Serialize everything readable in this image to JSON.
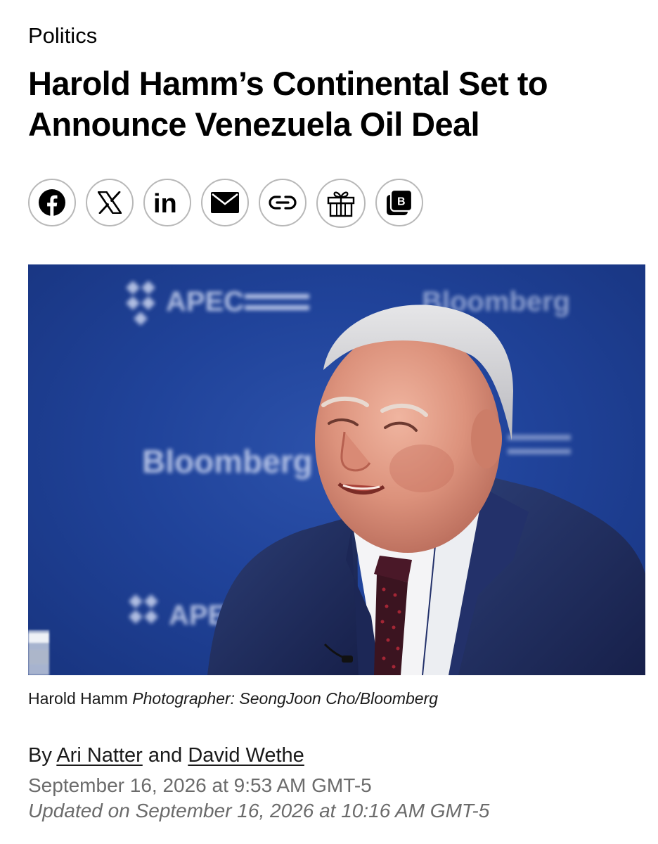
{
  "article": {
    "section": "Politics",
    "headline": "Harold Hamm’s Continental Set to Announce Venezuela Oil Deal"
  },
  "share": {
    "buttons": [
      {
        "icon": "facebook-icon"
      },
      {
        "icon": "x-icon"
      },
      {
        "icon": "linkedin-icon"
      },
      {
        "icon": "email-icon"
      },
      {
        "icon": "link-icon"
      },
      {
        "icon": "gift-icon"
      },
      {
        "icon": "bloomberg-b-icon"
      }
    ]
  },
  "photo": {
    "caption_subject": "Harold Hamm",
    "caption_credit": "Photographer: SeongJoon Cho/Bloomberg",
    "backdrop_logo_text": [
      "APEC",
      "Bloomberg"
    ]
  },
  "byline": {
    "prefix": "By",
    "author_1": "Ari Natter",
    "conjunction": "and",
    "author_2": "David Wethe"
  },
  "dates": {
    "published": "September 16, 2026 at 9:53 AM GMT-5",
    "updated": "Updated on September 16, 2026 at 10:16 AM GMT-5"
  },
  "colors": {
    "backdrop_blue": "#20439a",
    "suit_navy": "#1f2c55",
    "meta_gray": "#6b6b6b",
    "icon_border": "#b8b8b8"
  }
}
